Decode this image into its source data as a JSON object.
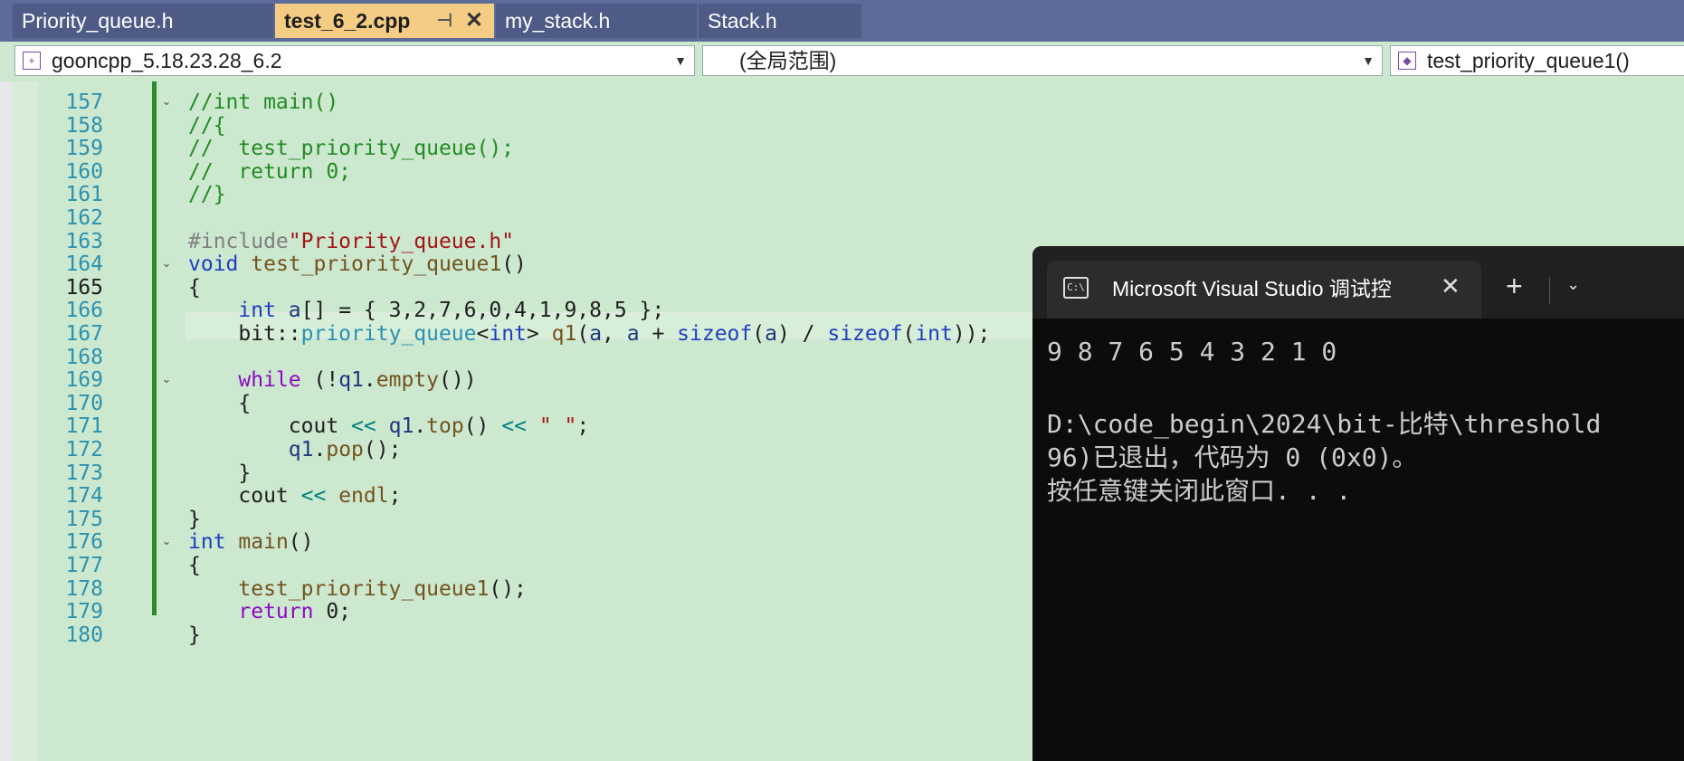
{
  "tabs": [
    {
      "label": "Priority_queue.h",
      "active": false
    },
    {
      "label": "test_6_2.cpp",
      "active": true
    },
    {
      "label": "my_stack.h",
      "active": false
    },
    {
      "label": "Stack.h",
      "active": false
    }
  ],
  "tab_icons": {
    "pin": "⊣",
    "close": "✕"
  },
  "navbar": {
    "project": "gooncpp_5.18.23.28_6.2",
    "scope": "(全局范围)",
    "function": "test_priority_queue1()"
  },
  "editor": {
    "current_line": 165,
    "lines": [
      {
        "n": "157",
        "fold": true,
        "code": "//int main()"
      },
      {
        "n": "158",
        "fold": false,
        "code": "//{"
      },
      {
        "n": "159",
        "fold": false,
        "code": "//  test_priority_queue();"
      },
      {
        "n": "160",
        "fold": false,
        "code": "//  return 0;"
      },
      {
        "n": "161",
        "fold": false,
        "code": "//}"
      },
      {
        "n": "162",
        "fold": false,
        "code": ""
      },
      {
        "n": "163",
        "fold": false,
        "code": "#include\"Priority_queue.h\""
      },
      {
        "n": "164",
        "fold": true,
        "code": "void test_priority_queue1()"
      },
      {
        "n": "165",
        "fold": false,
        "code": "{"
      },
      {
        "n": "166",
        "fold": false,
        "code": "    int a[] = { 3,2,7,6,0,4,1,9,8,5 };"
      },
      {
        "n": "167",
        "fold": false,
        "code": "    bit::priority_queue<int> q1(a, a + sizeof(a) / sizeof(int));"
      },
      {
        "n": "168",
        "fold": false,
        "code": ""
      },
      {
        "n": "169",
        "fold": true,
        "code": "    while (!q1.empty())"
      },
      {
        "n": "170",
        "fold": false,
        "code": "    {"
      },
      {
        "n": "171",
        "fold": false,
        "code": "        cout << q1.top() << \" \";"
      },
      {
        "n": "172",
        "fold": false,
        "code": "        q1.pop();"
      },
      {
        "n": "173",
        "fold": false,
        "code": "    }"
      },
      {
        "n": "174",
        "fold": false,
        "code": "    cout << endl;"
      },
      {
        "n": "175",
        "fold": false,
        "code": "}"
      },
      {
        "n": "176",
        "fold": true,
        "code": "int main()"
      },
      {
        "n": "177",
        "fold": false,
        "code": "{"
      },
      {
        "n": "178",
        "fold": false,
        "code": "    test_priority_queue1();"
      },
      {
        "n": "179",
        "fold": false,
        "code": "    return 0;"
      },
      {
        "n": "180",
        "fold": false,
        "code": "}"
      }
    ]
  },
  "console": {
    "title": "Microsoft Visual Studio 调试控",
    "icon_text": "C:\\",
    "plus": "+",
    "output_lines": [
      "9 8 7 6 5 4 3 2 1 0",
      "",
      "D:\\code_begin\\2024\\bit-比特\\threshold",
      "96)已退出，代码为 0 (0x0)。",
      "按任意键关闭此窗口. . ."
    ]
  }
}
